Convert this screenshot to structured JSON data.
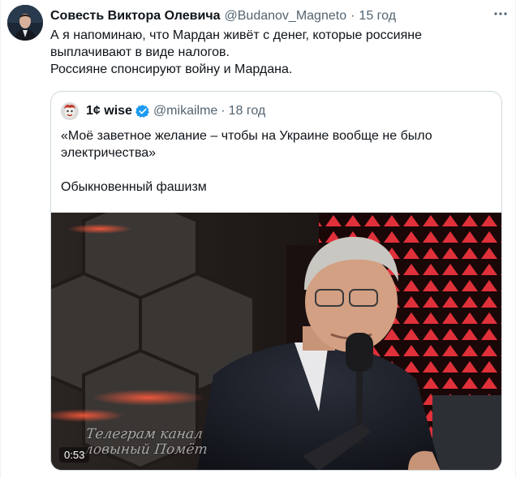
{
  "tweet": {
    "display_name": "Совесть Виктора Олевича",
    "handle": "@Budanov_Magneto",
    "separator": "·",
    "time": "15 год",
    "more_label": "···",
    "lines": [
      "А я напоминаю, что Мардан живёт с денег, которые россияне",
      "выплачивают в виде налогов.",
      "Россияне спонсируют войну и Мардана."
    ]
  },
  "quoted": {
    "display_name": "1¢ wise",
    "handle": "@mikailme",
    "separator": "·",
    "time": "18 год",
    "lines": [
      "«Моё заветное желание – чтобы на Украине вообще не было",
      "электричества»",
      "Обыкновенный фашизм"
    ],
    "video": {
      "duration": "0:53",
      "watermark_lines": [
        "Телеграм канал",
        "ловыный Помёт"
      ]
    }
  },
  "colors": {
    "text": "#0f1419",
    "secondary": "#536471",
    "border": "#cfd9de",
    "verified": "#1d9bf0",
    "studio_red": "#e0303a"
  },
  "icons": {
    "more": "more-horizontal-icon",
    "verified": "verified-badge-icon"
  }
}
